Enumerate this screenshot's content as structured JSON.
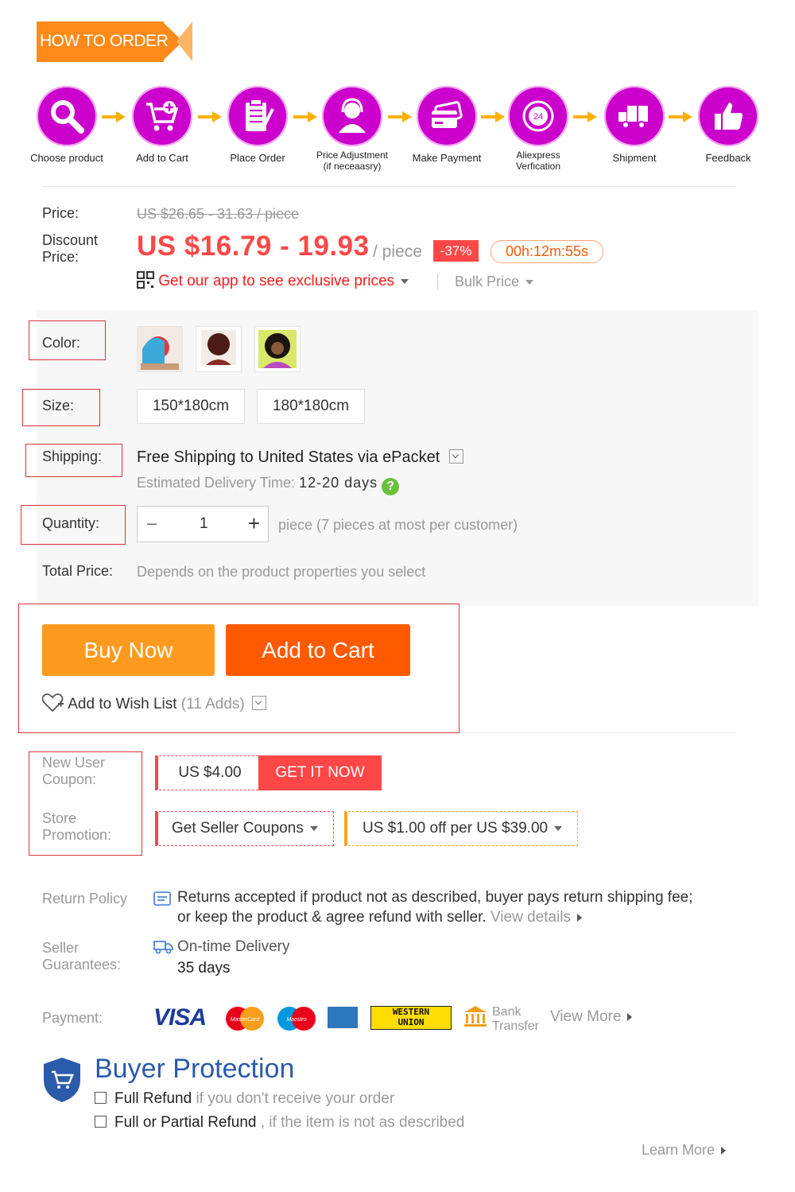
{
  "header": {
    "how_to_order": "HOW TO ORDER"
  },
  "steps": [
    {
      "label": "Choose product",
      "icon": "search-icon"
    },
    {
      "label": "Add to Cart",
      "icon": "cart-icon"
    },
    {
      "label": "Place Order",
      "icon": "clipboard-icon"
    },
    {
      "label": "Price Adjustment",
      "label2": "(if neceaasry)",
      "icon": "agent-icon"
    },
    {
      "label": "Make Payment",
      "icon": "credit-card-icon"
    },
    {
      "label": "Aliexpress",
      "label2": "Verfication",
      "icon": "clock-24-icon"
    },
    {
      "label": "Shipment",
      "icon": "truck-icon"
    },
    {
      "label": "Feedback",
      "icon": "thumbs-up-icon"
    }
  ],
  "price": {
    "price_label": "Price:",
    "original": "US $26.65 - 31.63 / piece",
    "discount_label_1": "Discount",
    "discount_label_2": "Price:",
    "discount": "US $16.79 - 19.93",
    "unit": "/ piece",
    "off_badge": "-37%",
    "timer": "00h:12m:55s",
    "app_promo": "Get our app to see exclusive prices",
    "bulk_price": "Bulk Price"
  },
  "options": {
    "color_label": "Color:",
    "size_label": "Size:",
    "sizes": [
      "150*180cm",
      "180*180cm"
    ],
    "shipping_label": "Shipping:",
    "shipping_text": "Free Shipping to United States via ePacket",
    "delivery_label": "Estimated Delivery Time:",
    "delivery_value": "12-20 days",
    "quantity_label": "Quantity:",
    "quantity_minus": "–",
    "quantity_value": "1",
    "quantity_plus": "+",
    "quantity_note": "piece (7 pieces at most per customer)",
    "total_label": "Total Price:",
    "total_text": "Depends on the product properties you select"
  },
  "actions": {
    "buy_now": "Buy Now",
    "add_to_cart": "Add to Cart",
    "wishlist": "Add to Wish List",
    "wishlist_count": "(11 Adds)"
  },
  "coupons": {
    "new_user_label_1": "New User",
    "new_user_label_2": "Coupon:",
    "new_user_value": "US $4.00",
    "get_it_now": "GET IT NOW",
    "store_label_1": "Store",
    "store_label_2": "Promotion:",
    "seller_coupons": "Get Seller Coupons",
    "store_offer": "US $1.00 off per US $39.00"
  },
  "policy": {
    "return_label": "Return Policy",
    "return_line1": "Returns accepted if product not as described, buyer pays return shipping fee;",
    "return_line2": "or keep the product & agree refund with seller.",
    "view_details": "View details",
    "guarantee_label_1": "Seller",
    "guarantee_label_2": "Guarantees:",
    "ontime": "On-time Delivery",
    "days": "35 days",
    "payment_label": "Payment:",
    "visa": "VISA",
    "mastercard": "MasterCard",
    "maestro": "Maestro",
    "western_union_1": "WESTERN",
    "western_union_2": "UNION",
    "bank_1": "Bank",
    "bank_2": "Transfer",
    "view_more": "View More"
  },
  "protection": {
    "title": "Buyer Protection",
    "line1_bold": "Full Refund",
    "line1_rest": "if you don't receive your order",
    "line2_bold": "Full or Partial Refund",
    "line2_rest": ", if the item is not as described",
    "learn_more": "Learn More"
  },
  "colors": {
    "accent": "#ff4747",
    "orange": "#ff5a00",
    "magenta": "#cc00cc",
    "blue": "#2a5bab"
  }
}
